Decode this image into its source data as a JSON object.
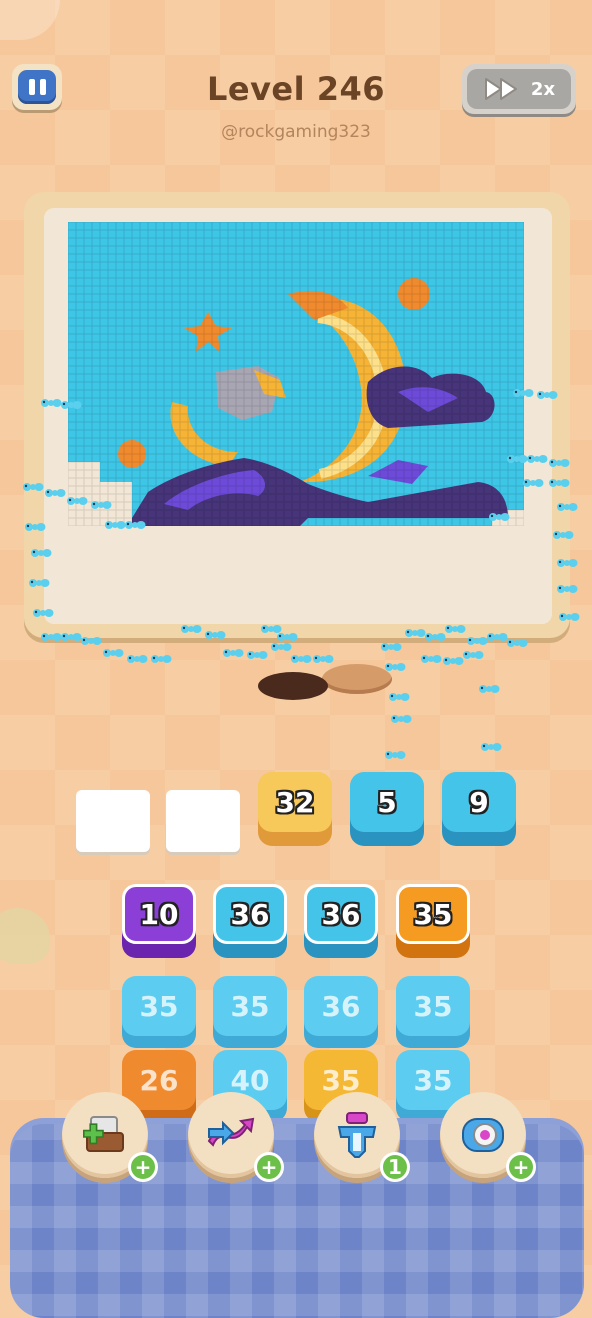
{
  "header": {
    "level_title": "Level 246",
    "handle": "@rockgaming323",
    "speed_label": "2x",
    "pause_icon": "pause-icon",
    "speed_icon": "fast-forward-icon"
  },
  "queue": {
    "empty_slots": 2,
    "tiles": [
      {
        "value": "32",
        "color": "#f7c85a"
      },
      {
        "value": "5",
        "color": "#45c4ea"
      },
      {
        "value": "9",
        "color": "#45c4ea"
      }
    ]
  },
  "grid": {
    "rows": [
      [
        {
          "value": "10",
          "color": "#8b3fd6",
          "active": true
        },
        {
          "value": "36",
          "color": "#45c4ea",
          "active": true
        },
        {
          "value": "36",
          "color": "#45c4ea",
          "active": true
        },
        {
          "value": "35",
          "color": "#f59b22",
          "active": true
        }
      ],
      [
        {
          "value": "35",
          "color": "#45c4ea",
          "active": false
        },
        {
          "value": "35",
          "color": "#45c4ea",
          "active": false
        },
        {
          "value": "36",
          "color": "#45c4ea",
          "active": false
        },
        {
          "value": "35",
          "color": "#45c4ea",
          "active": false
        }
      ],
      [
        {
          "value": "26",
          "color": "#f08a2e",
          "active": false
        },
        {
          "value": "40",
          "color": "#45c4ea",
          "active": false
        },
        {
          "value": "35",
          "color": "#f5b834",
          "active": false
        },
        {
          "value": "35",
          "color": "#45c4ea",
          "active": false
        }
      ]
    ]
  },
  "boosters": [
    {
      "name": "add-slot-booster",
      "icon": "box-plus-icon",
      "badge": "+"
    },
    {
      "name": "shuffle-booster",
      "icon": "shuffle-arrows-icon",
      "badge": "+"
    },
    {
      "name": "magnet-booster",
      "icon": "magnet-icon",
      "badge": "1"
    },
    {
      "name": "swap-booster",
      "icon": "donut-swap-icon",
      "badge": "+"
    }
  ],
  "colors": {
    "pixel_sky": "#3ec6e6",
    "pixel_moon": "#f6b437",
    "pixel_cloud_dark": "#473479",
    "pixel_cloud_light": "#6d4bd8",
    "pixel_star": "#f08a2e",
    "ant": "#5bd0ee"
  }
}
